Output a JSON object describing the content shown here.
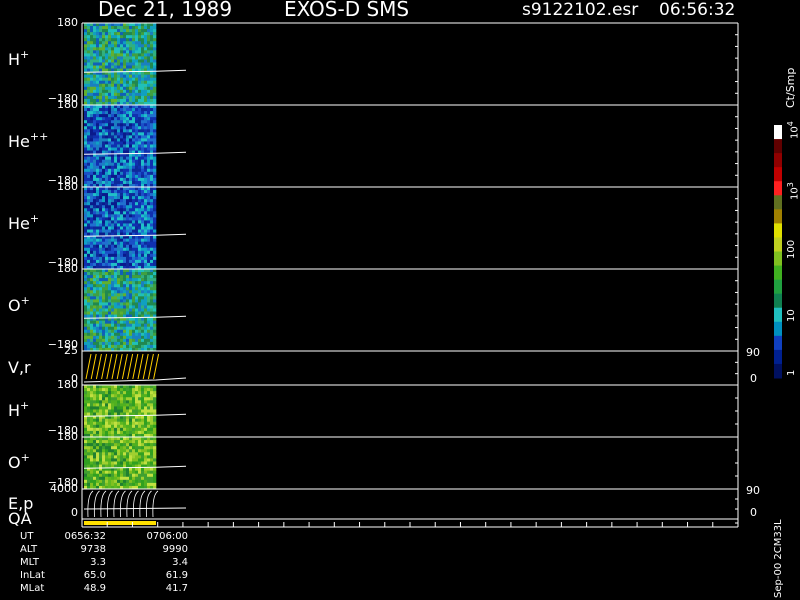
{
  "header": {
    "date": "Dec 21, 1989",
    "instrument": "EXOS-D SMS",
    "file": "s9122102.esr",
    "time": "06:56:32"
  },
  "colorbar": {
    "unit": "Ct/Smp",
    "labels": [
      "1",
      "10",
      "100",
      "10",
      "10"
    ],
    "exponents": [
      "",
      "",
      "",
      "3",
      "4"
    ]
  },
  "footer_id": "Sep-00 2CM33L",
  "chart_data": {
    "type": "heatmap",
    "panels": [
      {
        "label": "H",
        "sup": "+",
        "ytop": "180",
        "ybot": "−180",
        "kind": "spec",
        "palette": "mixed"
      },
      {
        "label": "He",
        "sup": "++",
        "ytop": "180",
        "ybot": "−180",
        "kind": "spec",
        "palette": "blue"
      },
      {
        "label": "He",
        "sup": "+",
        "ytop": "180",
        "ybot": "−180",
        "kind": "spec",
        "palette": "blue"
      },
      {
        "label": "O",
        "sup": "+",
        "ytop": "180",
        "ybot": "−180",
        "kind": "spec",
        "palette": "mixed"
      },
      {
        "label": "V,r",
        "sup": "",
        "ytop": "25",
        "ybot": "0",
        "rtop": "90",
        "rbot": "0",
        "kind": "line"
      },
      {
        "label": "H",
        "sup": "+",
        "ytop": "180",
        "ybot": "−180",
        "kind": "spec",
        "palette": "green"
      },
      {
        "label": "O",
        "sup": "+",
        "ytop": "180",
        "ybot": "−180",
        "kind": "spec",
        "palette": "green"
      },
      {
        "label": "E,p",
        "sup": "",
        "ytop": "4000",
        "ybot": "0",
        "rtop": "90",
        "rbot": "0",
        "kind": "curves"
      },
      {
        "label": "QA",
        "sup": "",
        "kind": "qa"
      }
    ],
    "orbit": {
      "labels": [
        "UT",
        "ALT",
        "MLT",
        "InLat",
        "MLat"
      ],
      "col1": [
        "0656:32",
        "9738",
        "3.3",
        "65.0",
        "48.9"
      ],
      "col2": [
        "0706:00",
        "9990",
        "3.4",
        "61.9",
        "41.7"
      ]
    }
  }
}
